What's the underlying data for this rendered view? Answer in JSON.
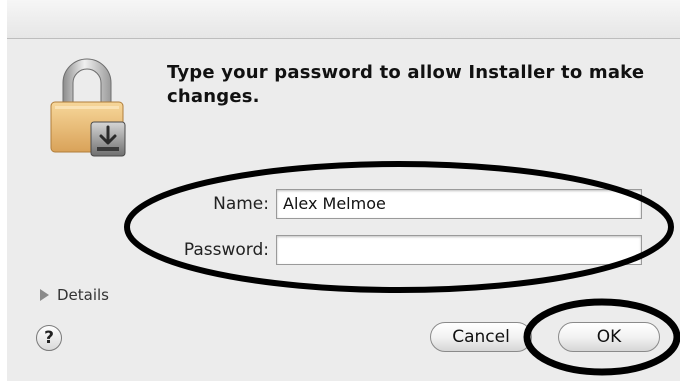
{
  "dialog": {
    "message": "Type your password to allow Installer to make changes.",
    "icon": "padlock-installer-icon"
  },
  "form": {
    "name_label": "Name:",
    "name_value": "Alex Melmoe",
    "password_label": "Password:",
    "password_value": ""
  },
  "footer": {
    "details_label": "Details",
    "help_label": "?",
    "cancel_label": "Cancel",
    "ok_label": "OK"
  }
}
